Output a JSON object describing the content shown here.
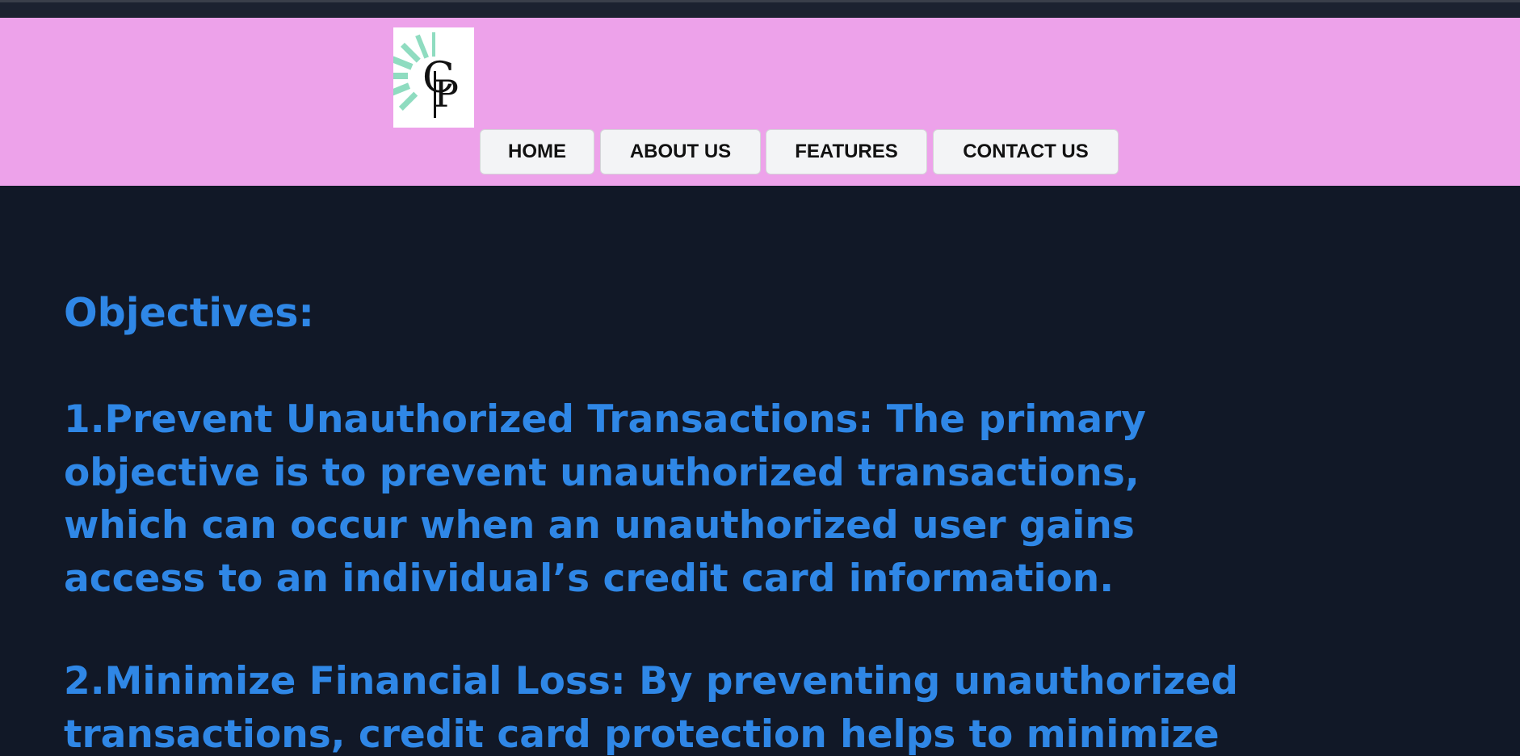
{
  "brand": {
    "logo_text": "CP",
    "accent_color": "#8fdcc0"
  },
  "nav": {
    "items": [
      {
        "label": "HOME"
      },
      {
        "label": "ABOUT US"
      },
      {
        "label": "FEATURES"
      },
      {
        "label": "CONTACT US"
      }
    ]
  },
  "main": {
    "heading": "Objectives:",
    "objectives": [
      {
        "title": "1.Prevent Unauthorized Transactions:",
        "text": "The primary objective is to prevent unauthorized transactions, which can occur when an unauthorized user gains access to an individual’s credit card information."
      },
      {
        "title": "2.Minimize Financial Loss:",
        "text": "By preventing unauthorized transactions, credit card protection helps to minimize"
      }
    ]
  },
  "colors": {
    "header_bg": "#eda2ea",
    "page_bg": "#111827",
    "text_accent": "#2f87e6"
  }
}
